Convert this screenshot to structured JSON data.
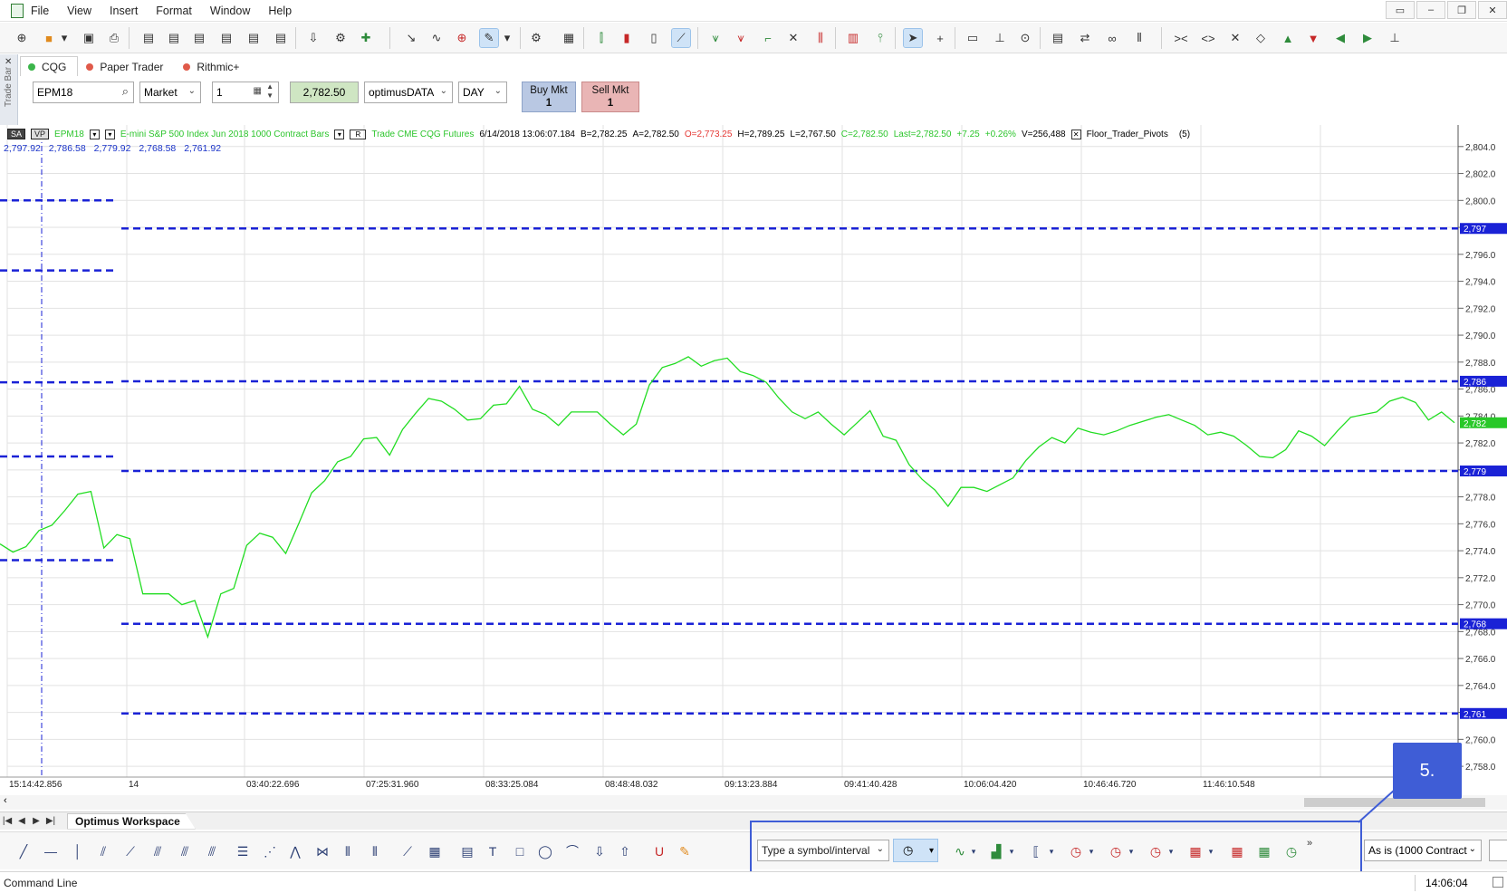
{
  "menu": [
    "File",
    "View",
    "Insert",
    "Format",
    "Window",
    "Help"
  ],
  "window_buttons": [
    "▭",
    "–",
    "❐",
    "✕"
  ],
  "tradebar": {
    "side_label": "Trade Bar",
    "close": "✕",
    "tabs": [
      {
        "label": "CQG",
        "dot": "#3bb54a"
      },
      {
        "label": "Paper Trader",
        "dot": "#e05a4a"
      },
      {
        "label": "Rithmic+",
        "dot": "#e05a4a"
      }
    ],
    "symbol": "EPM18",
    "order_type": "Market",
    "quantity": "1",
    "price": "2,782.50",
    "account": "optimusDATA",
    "duration": "DAY",
    "buy": {
      "label": "Buy Mkt",
      "qty": "1"
    },
    "sell": {
      "label": "Sell Mkt",
      "qty": "1"
    }
  },
  "chart_header": {
    "chip_sa": "SA",
    "chip_vp": "VP",
    "symbol": "EPM18",
    "description": "E-mini S&P 500 Index Jun 2018  1000 Contract Bars",
    "r_chip": "R",
    "feed": "Trade  CME  CQG  Futures",
    "timestamp": "6/14/2018  13:06:07.184",
    "bid": "B=2,782.25",
    "ask": "A=2,782.50",
    "open": "O=2,773.25",
    "high": "H=2,789.25",
    "low": "L=2,767.50",
    "close": "C=2,782.50",
    "last": "Last=2,782.50",
    "change": "+7.25",
    "change_pct": "+0.26%",
    "volume": "V=256,488",
    "study": "Floor_Trader_Pivots",
    "study_param": "(5)"
  },
  "pivot_values": [
    "2,797.92",
    "2,786.58",
    "2,779.92",
    "2,768.58",
    "2,761.92"
  ],
  "chart_data": {
    "type": "line",
    "x_labels": [
      "15:14:42.856",
      "14",
      "03:40:22.696",
      "07:25:31.960",
      "08:33:25.084",
      "08:48:48.032",
      "09:13:23.884",
      "09:41:40.428",
      "10:06:04.420",
      "10:46:46.720",
      "11:46:10.548"
    ],
    "y_ticks": [
      "2,804.0",
      "2,802.0",
      "2,800.0",
      "2,798.0",
      "2,796.0",
      "2,794.0",
      "2,792.0",
      "2,790.0",
      "2,788.0",
      "2,786.0",
      "2,784.0",
      "2,782.0",
      "2,780.0",
      "2,778.0",
      "2,776.0",
      "2,774.0",
      "2,772.0",
      "2,770.0",
      "2,768.0",
      "2,766.0",
      "2,764.0",
      "2,762.0",
      "2,760.0",
      "2,758.0"
    ],
    "ylim": [
      2757.2,
      2805.6
    ],
    "series": [
      {
        "color": "#22dd22",
        "values": [
          2774.5,
          2773.9,
          2774.3,
          2775.5,
          2775.9,
          2777.0,
          2778.2,
          2778.4,
          2774.2,
          2775.2,
          2774.9,
          2770.8,
          2770.8,
          2770.8,
          2770.0,
          2770.3,
          2767.6,
          2770.8,
          2771.2,
          2774.4,
          2775.3,
          2775.0,
          2773.8,
          2776.0,
          2778.3,
          2779.2,
          2780.6,
          2781.0,
          2782.3,
          2782.4,
          2781.1,
          2783.0,
          2784.2,
          2785.3,
          2785.1,
          2784.5,
          2783.7,
          2783.8,
          2784.8,
          2784.9,
          2786.2,
          2784.5,
          2784.1,
          2783.3,
          2784.3,
          2784.3,
          2784.3,
          2783.4,
          2782.6,
          2783.4,
          2786.3,
          2787.6,
          2787.9,
          2788.4,
          2787.7,
          2788.1,
          2788.3,
          2787.3,
          2787.0,
          2786.5,
          2785.3,
          2784.3,
          2783.8,
          2784.3,
          2783.4,
          2782.6,
          2783.5,
          2784.4,
          2782.5,
          2782.2,
          2780.4,
          2779.3,
          2778.5,
          2777.3,
          2778.7,
          2778.7,
          2778.4,
          2778.9,
          2779.4,
          2780.7,
          2781.7,
          2782.4,
          2782.0,
          2783.1,
          2782.8,
          2782.6,
          2782.9,
          2783.3,
          2783.6,
          2783.9,
          2784.1,
          2783.7,
          2783.3,
          2782.6,
          2782.8,
          2782.5,
          2781.8,
          2781.0,
          2780.9,
          2781.5,
          2782.9,
          2782.5,
          2781.8,
          2782.9,
          2783.9,
          2784.1,
          2784.3,
          2785.1,
          2785.4,
          2785.0,
          2783.7,
          2784.3,
          2783.5
        ]
      }
    ],
    "pivot_levels": [
      {
        "label": "2,797",
        "value": 2797.92
      },
      {
        "label": "2,786",
        "value": 2786.58
      },
      {
        "label": "2,779",
        "value": 2779.92
      },
      {
        "label": "2,768",
        "value": 2768.58
      },
      {
        "label": "2,761",
        "value": 2761.92
      }
    ],
    "prior_pivot_levels": [
      2800.0,
      2794.8,
      2786.5,
      2781.0,
      2773.3
    ],
    "last_price_label": "2,782",
    "pivot_color": "#1a22d6",
    "grid": true
  },
  "workspace": {
    "tab": "Optimus Workspace",
    "nav": [
      "|◀",
      "◀",
      "▶",
      "▶|"
    ]
  },
  "drawbar": {
    "symbol_placeholder": "Type a symbol/interval",
    "aggregation": "As is (1000 Contract",
    "overflow": "»"
  },
  "callout": {
    "label": "5."
  },
  "status": {
    "command_line": "Command Line",
    "time": "14:06:04"
  }
}
